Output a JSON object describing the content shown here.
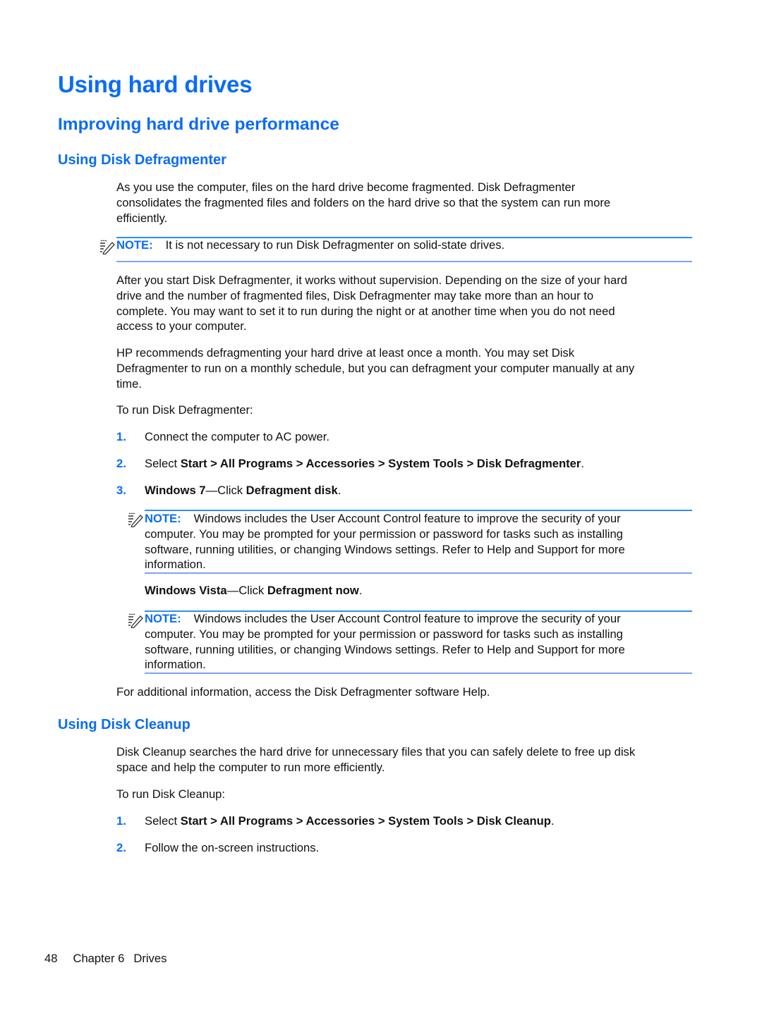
{
  "headings": {
    "title": "Using hard drives",
    "section": "Improving hard drive performance",
    "defrag_heading": "Using Disk Defragmenter",
    "cleanup_heading": "Using Disk Cleanup"
  },
  "defrag": {
    "intro_lines": [
      "As you use the computer, files on the hard drive become fragmented. Disk Defragmenter",
      "consolidates the fragmented files and folders on the hard drive so that the system can run more",
      "efficiently."
    ],
    "note1": {
      "label": "NOTE:",
      "lines": [
        "It is not necessary to run Disk Defragmenter on solid-state drives."
      ]
    },
    "para2_lines": [
      "After you start Disk Defragmenter, it works without supervision. Depending on the size of your hard",
      "drive and the number of fragmented files, Disk Defragmenter may take more than an hour to",
      "complete. You may want to set it to run during the night or at another time when you do not need",
      "access to your computer."
    ],
    "para3_lines": [
      "HP recommends defragmenting your hard drive at least once a month. You may set Disk",
      "Defragmenter to run on a monthly schedule, but you can defragment your computer manually at any",
      "time."
    ],
    "run_intro": "To run Disk Defragmenter:",
    "steps": [
      {
        "num": "1.",
        "text": "Connect the computer to AC power."
      },
      {
        "num": "2.",
        "prefix": "Select ",
        "path": [
          "Start",
          "All Programs",
          "Accessories",
          "System Tools",
          "Disk Defragmenter"
        ],
        "separator": " > ",
        "suffix": "."
      },
      {
        "num": "3.",
        "os": "Windows 7",
        "dash": "—Click ",
        "action": "Defragment disk",
        "suffix": "."
      }
    ],
    "note2": {
      "label": "NOTE:",
      "first_line": "Windows includes the User Account Control feature to improve the security of your",
      "lines": [
        "computer. You may be prompted for your permission or password for tasks such as installing",
        "software, running utilities, or changing Windows settings. Refer to Help and Support for more",
        "information."
      ]
    },
    "vista": {
      "os": "Windows Vista",
      "dash": "—Click ",
      "action": "Defragment now",
      "suffix": "."
    },
    "note3": {
      "label": "NOTE:",
      "first_line": "Windows includes the User Account Control feature to improve the security of your",
      "lines": [
        "computer. You may be prompted for your permission or password for tasks such as installing",
        "software, running utilities, or changing Windows settings. Refer to Help and Support for more",
        "information."
      ]
    },
    "additional": "For additional information, access the Disk Defragmenter software Help."
  },
  "cleanup": {
    "intro_lines": [
      "Disk Cleanup searches the hard drive for unnecessary files that you can safely delete to free up disk",
      "space and help the computer to run more efficiently."
    ],
    "run_intro": "To run Disk Cleanup:",
    "steps": [
      {
        "num": "1.",
        "prefix": "Select ",
        "path": [
          "Start",
          "All Programs",
          "Accessories",
          "System Tools",
          "Disk Cleanup"
        ],
        "separator": " > ",
        "suffix": "."
      },
      {
        "num": "2.",
        "text": "Follow the on-screen instructions."
      }
    ]
  },
  "footer": {
    "page_number": "48",
    "chapter": "Chapter 6",
    "chapter_title": "Drives"
  },
  "icons": {
    "note": "note-pencil-icon"
  },
  "colors": {
    "heading": "#0a6cf5",
    "note_top_rule": "#2e8ff0",
    "note_bottom_rule": "#7fa3f0"
  }
}
